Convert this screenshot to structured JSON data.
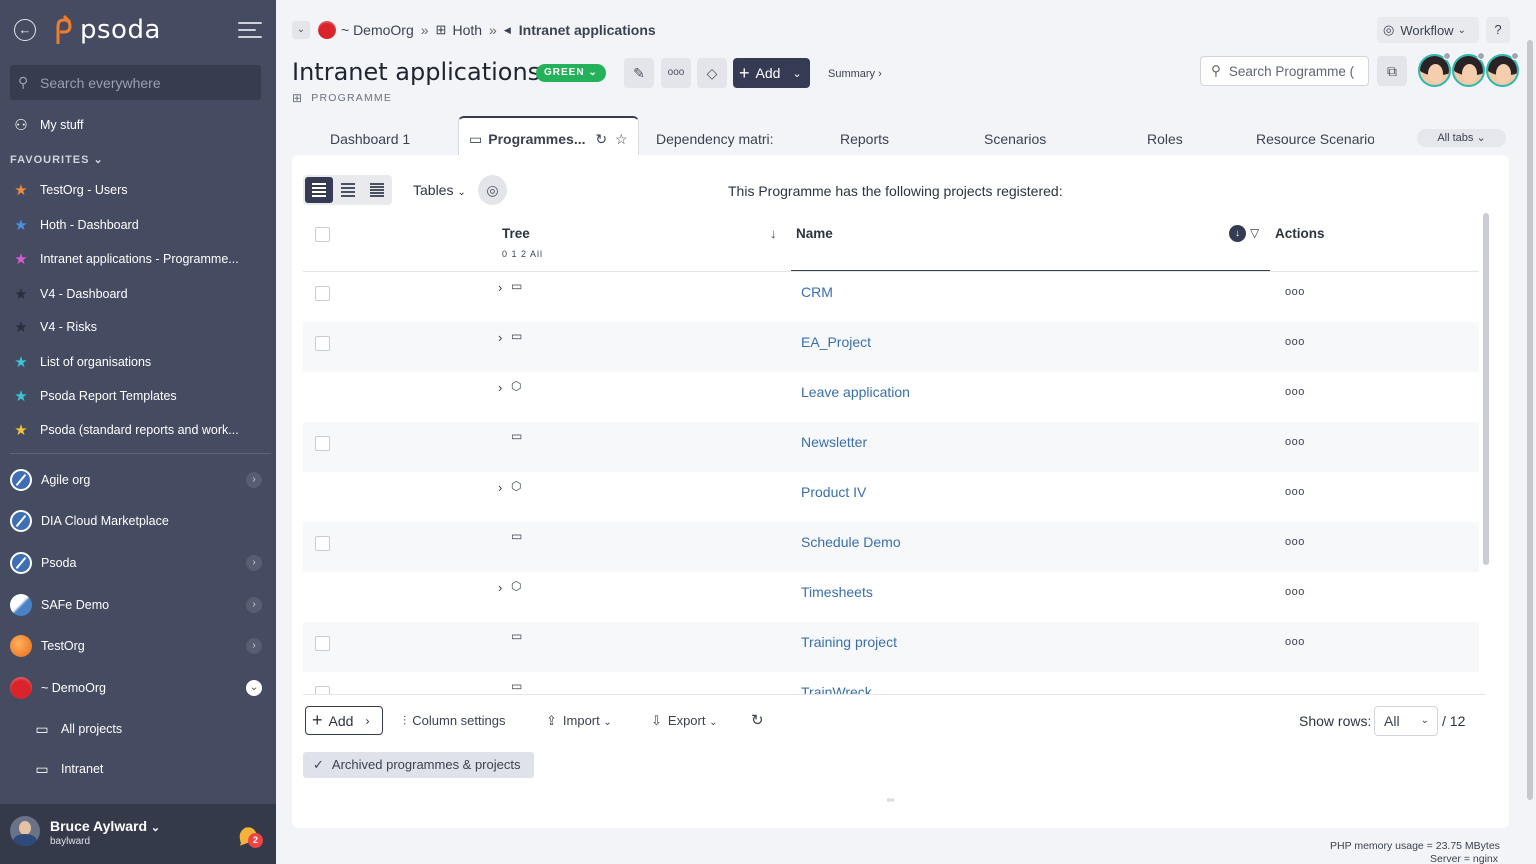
{
  "sidebar": {
    "logo_text": "psoda",
    "search_placeholder": "Search everywhere",
    "my_stuff": "My stuff",
    "favourites_header": "FAVOURITES",
    "favourites": [
      {
        "label": "TestOrg - Users",
        "color": "#f08a3c"
      },
      {
        "label": "Hoth - Dashboard",
        "color": "#4a8fe0"
      },
      {
        "label": "Intranet applications - Programme...",
        "color": "#d75bd2"
      },
      {
        "label": "V4 - Dashboard",
        "color": "#2a2f3d"
      },
      {
        "label": "V4 - Risks",
        "color": "#2a2f3d"
      },
      {
        "label": "List of organisations",
        "color": "#3ec4d8"
      },
      {
        "label": "Psoda Report Templates",
        "color": "#3ec4d8"
      },
      {
        "label": "Psoda (standard reports and work...",
        "color": "#f2c23a"
      }
    ],
    "orgs": [
      {
        "label": "Agile org"
      },
      {
        "label": "DIA Cloud Marketplace"
      },
      {
        "label": "Psoda"
      },
      {
        "label": "SAFe Demo"
      },
      {
        "label": "TestOrg"
      },
      {
        "label": "~ DemoOrg"
      }
    ],
    "sub_items": [
      "All projects",
      "Intranet"
    ],
    "user": {
      "name": "Bruce Aylward",
      "handle": "baylward",
      "notifications": "2"
    }
  },
  "breadcrumb": {
    "org": "~ DemoOrg",
    "parent": "Hoth",
    "current": "Intranet applications"
  },
  "header": {
    "workflow_label": "Workflow",
    "help_label": "?",
    "title": "Intranet applications",
    "status": "GREEN",
    "type_label": "PROGRAMME",
    "add_label": "Add",
    "summary_label": "Summary",
    "search_placeholder": "Search Programme (",
    "more_label": "ooo"
  },
  "tabs": [
    {
      "label": "Dashboard 1"
    },
    {
      "label": "Programmes..."
    },
    {
      "label": "Dependency matri:"
    },
    {
      "label": "Reports"
    },
    {
      "label": "Scenarios"
    },
    {
      "label": "Roles"
    },
    {
      "label": "Resource Scenario:"
    }
  ],
  "all_tabs_label": "All tabs",
  "panel": {
    "tables_label": "Tables",
    "message": "This Programme has the following projects registered:",
    "columns": {
      "tree": "Tree",
      "tree_levels": "0 1 2 All",
      "name": "Name",
      "actions": "Actions"
    },
    "rows": [
      {
        "name": "CRM",
        "checkbox": true,
        "expand": true,
        "node": "folder"
      },
      {
        "name": "EA_Project",
        "checkbox": true,
        "expand": true,
        "node": "folder"
      },
      {
        "name": "Leave application",
        "checkbox": false,
        "expand": true,
        "node": "cube"
      },
      {
        "name": "Newsletter",
        "checkbox": true,
        "expand": false,
        "node": "folder"
      },
      {
        "name": "Product IV",
        "checkbox": false,
        "expand": true,
        "node": "cube"
      },
      {
        "name": "Schedule Demo",
        "checkbox": true,
        "expand": false,
        "node": "folder"
      },
      {
        "name": "Timesheets",
        "checkbox": false,
        "expand": true,
        "node": "cube"
      },
      {
        "name": "Training project",
        "checkbox": true,
        "expand": false,
        "node": "folder"
      },
      {
        "name": "TrainWreck",
        "checkbox": true,
        "expand": false,
        "node": "folder"
      }
    ],
    "actions_label": "ooo",
    "footer": {
      "add_label": "Add",
      "column_settings": "Column settings",
      "import": "Import",
      "export": "Export",
      "show_rows_label": "Show rows:",
      "show_rows_value": "All",
      "total": "/ 12",
      "archived_label": "Archived programmes & projects"
    }
  },
  "status_bar": {
    "memory": "PHP memory usage = 23.75 MBytes",
    "server": "Server = nginx"
  }
}
